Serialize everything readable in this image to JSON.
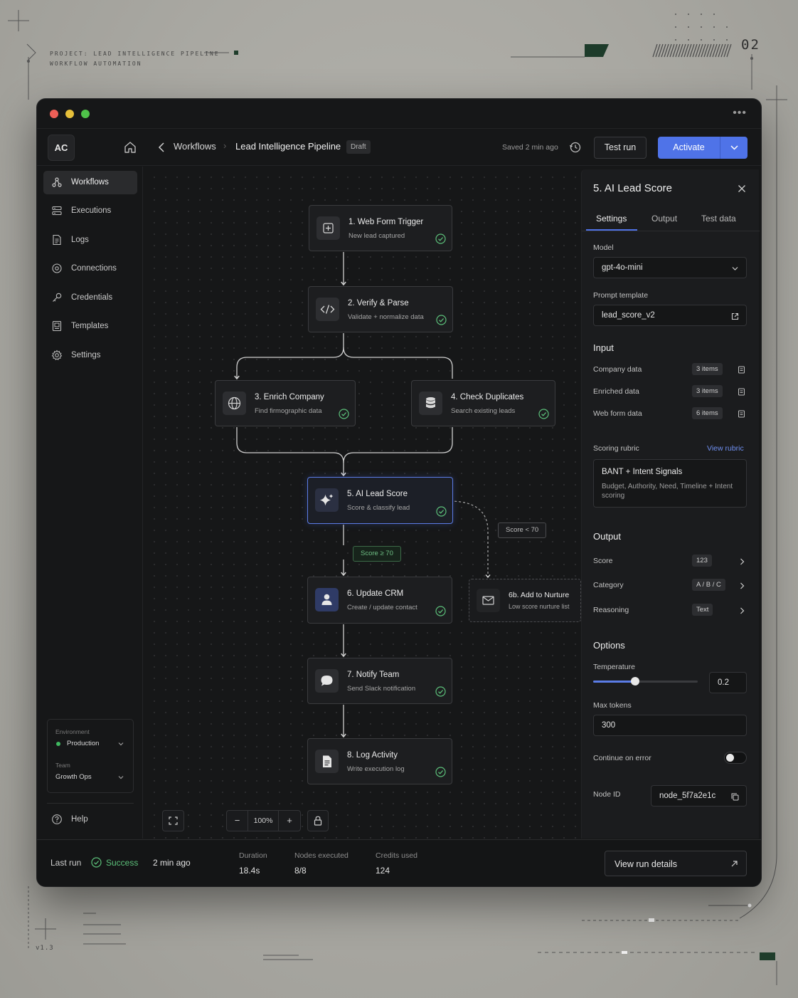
{
  "decor": {
    "project_line1": "PROJECT: LEAD INTELLIGENCE PIPELINE",
    "project_line2": "WORKFLOW AUTOMATION",
    "index": "02",
    "version": "v1.3"
  },
  "topbar": {
    "avatar": "AC",
    "breadcrumb_root": "Workflows",
    "breadcrumb_current": "Lead Intelligence Pipeline",
    "draft_badge": "Draft",
    "saved_status": "Saved 2 min ago",
    "test_run_label": "Test run",
    "activate_label": "Activate"
  },
  "sidebar": {
    "items": [
      {
        "label": "Workflows",
        "icon": "workflow-icon",
        "active": true
      },
      {
        "label": "Executions",
        "icon": "list-icon"
      },
      {
        "label": "Logs",
        "icon": "document-icon"
      },
      {
        "label": "Connections",
        "icon": "connection-icon"
      },
      {
        "label": "Credentials",
        "icon": "key-icon"
      },
      {
        "label": "Templates",
        "icon": "template-icon"
      },
      {
        "label": "Settings",
        "icon": "gear-icon"
      }
    ],
    "environment_label": "Environment",
    "environment_value": "Production",
    "environment_status_color": "#3fb960",
    "team_label": "Team",
    "team_value": "Growth Ops",
    "help_label": "Help"
  },
  "canvas": {
    "nodes": [
      {
        "title": "1. Web Form Trigger",
        "subtitle": "New lead captured",
        "icon": "form-trigger-icon",
        "status": "success"
      },
      {
        "title": "2. Verify & Parse",
        "subtitle": "Validate + normalize data",
        "icon": "code-icon",
        "status": "success"
      },
      {
        "title": "3. Enrich Company",
        "subtitle": "Find firmographic data",
        "icon": "globe-icon",
        "status": "success"
      },
      {
        "title": "4. Check Duplicates",
        "subtitle": "Search existing leads",
        "icon": "database-icon",
        "status": "success"
      },
      {
        "title": "5. AI Lead Score",
        "subtitle": "Score & classify lead",
        "icon": "sparkle-icon",
        "status": "success",
        "selected": true
      },
      {
        "title": "6. Update CRM",
        "subtitle": "Create / update contact",
        "icon": "user-icon",
        "status": "success"
      },
      {
        "title": "6b. Add to Nurture",
        "subtitle": "Low score nurture list",
        "icon": "mail-icon",
        "status": "skipped"
      },
      {
        "title": "7. Notify Team",
        "subtitle": "Send Slack notification",
        "icon": "chat-icon",
        "status": "success"
      },
      {
        "title": "8. Log Activity",
        "subtitle": "Write execution log",
        "icon": "file-icon",
        "status": "success"
      }
    ],
    "branch_high": "Score ≥ 70",
    "branch_low": "Score < 70",
    "zoom_level": "100%"
  },
  "panel": {
    "title": "5. AI Lead Score",
    "tabs": [
      "Settings",
      "Output",
      "Test data"
    ],
    "active_tab": "Settings",
    "model_label": "Model",
    "model_value": "gpt-4o-mini",
    "prompt_label": "Prompt template",
    "prompt_value": "lead_score_v2",
    "input_heading": "Input",
    "inputs": [
      {
        "label": "Company data",
        "count": "3 items"
      },
      {
        "label": "Enriched data",
        "count": "3 items"
      },
      {
        "label": "Web form data",
        "count": "6 items"
      }
    ],
    "rubric_label": "Scoring rubric",
    "rubric_link": "View rubric",
    "rubric_title": "BANT + Intent Signals",
    "rubric_desc": "Budget, Authority, Need, Timeline + Intent scoring",
    "output_heading": "Output",
    "outputs": [
      {
        "label": "Score",
        "type": "123"
      },
      {
        "label": "Category",
        "type": "A / B / C"
      },
      {
        "label": "Reasoning",
        "type": "Text"
      }
    ],
    "options_heading": "Options",
    "temperature_label": "Temperature",
    "temperature_value": "0.2",
    "temperature_fraction": 0.4,
    "max_tokens_label": "Max tokens",
    "max_tokens_value": "300",
    "continue_on_error_label": "Continue on error",
    "continue_on_error": false,
    "node_id_label": "Node ID",
    "node_id_value": "node_5f7a2e1c"
  },
  "status_bar": {
    "last_run_label": "Last run",
    "last_run_status": "Success",
    "last_run_time": "2 min ago",
    "duration_label": "Duration",
    "duration_value": "18.4s",
    "nodes_label": "Nodes executed",
    "nodes_value": "8/8",
    "credits_label": "Credits used",
    "credits_value": "124",
    "view_details_label": "View run details"
  },
  "colors": {
    "accent": "#4f73e8",
    "success": "#5cc07a",
    "window_bg": "#161718"
  }
}
